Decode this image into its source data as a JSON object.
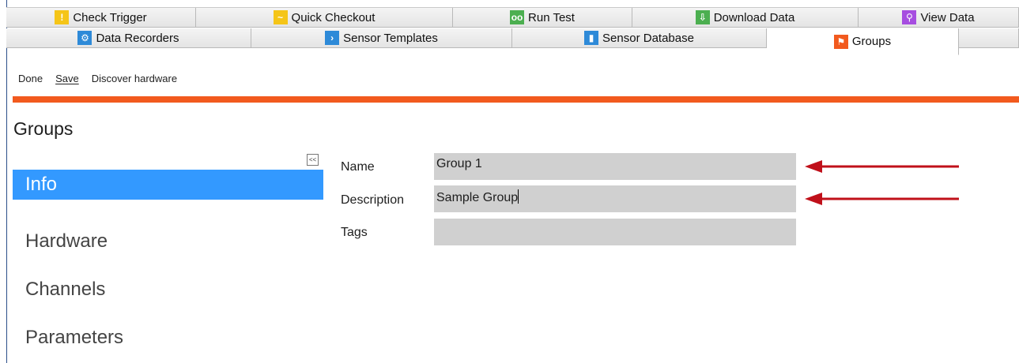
{
  "tabs_row1": [
    {
      "label": "Check Trigger",
      "icon": "check-trigger-icon",
      "color": "#f5c518"
    },
    {
      "label": "Quick Checkout",
      "icon": "quick-checkout-icon",
      "color": "#f5c518"
    },
    {
      "label": "Run Test",
      "icon": "run-test-icon",
      "color": "#4caf50"
    },
    {
      "label": "Download Data",
      "icon": "download-data-icon",
      "color": "#4caf50"
    },
    {
      "label": "View Data",
      "icon": "view-data-icon",
      "color": "#a64de0"
    }
  ],
  "tabs_row2": [
    {
      "label": "Data Recorders",
      "icon": "data-recorders-icon",
      "color": "#2e8ad8"
    },
    {
      "label": "Sensor Templates",
      "icon": "sensor-templates-icon",
      "color": "#2e8ad8"
    },
    {
      "label": "Sensor Database",
      "icon": "sensor-database-icon",
      "color": "#2e8ad8"
    },
    {
      "label": "Groups",
      "icon": "groups-icon",
      "color": "#f25a1e",
      "active": true
    }
  ],
  "toolbar": {
    "done_label": "Done",
    "save_label": "Save",
    "discover_label": "Discover hardware"
  },
  "page_title": "Groups",
  "collapse_label": "<<",
  "nav": {
    "items": [
      "Info",
      "Hardware",
      "Channels",
      "Parameters"
    ],
    "selected": "Info"
  },
  "form": {
    "name_label": "Name",
    "name_value": "Group 1",
    "description_label": "Description",
    "description_value": "Sample Group",
    "tags_label": "Tags",
    "tags_value": ""
  },
  "colors": {
    "accent_bar": "#f25a1e",
    "selection": "#3399ff",
    "arrow": "#c0101a",
    "field_bg": "#d0d0d0"
  }
}
